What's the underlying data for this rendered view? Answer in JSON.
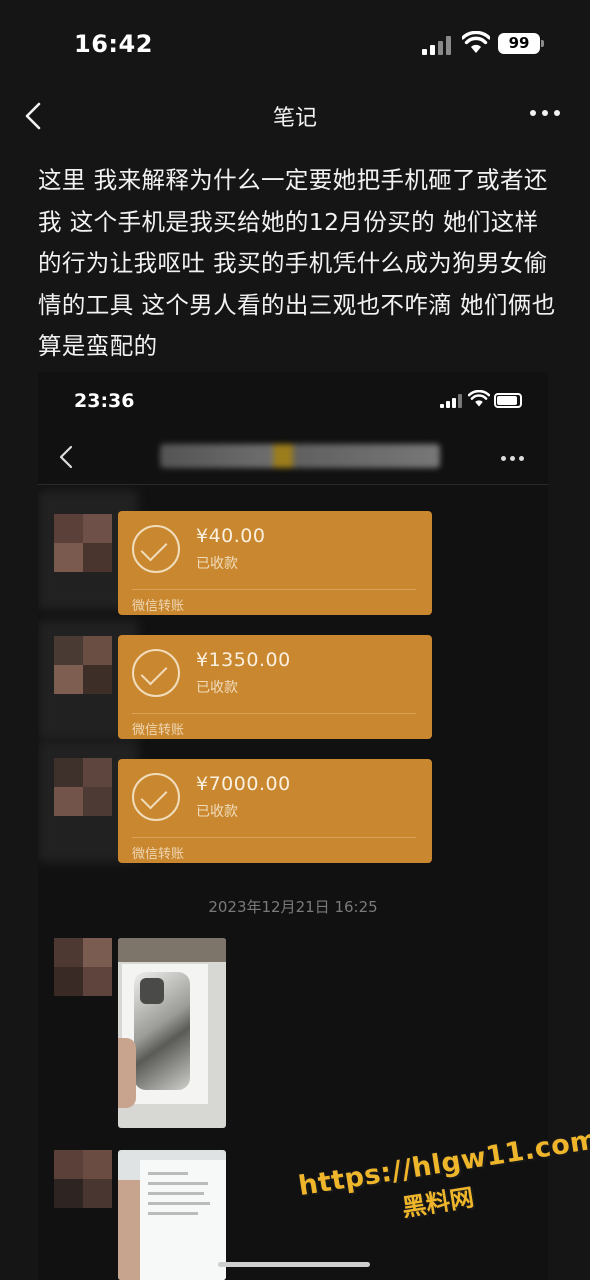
{
  "status_bar": {
    "time": "16:42",
    "battery": "99"
  },
  "header": {
    "title": "笔记"
  },
  "note": {
    "text": "这里 我来解释为什么一定要她把手机砸了或者还我 这个手机是我买给她的12月份买的 她们这样的行为让我呕吐 我买的手机凭什么成为狗男女偷情的工具 这个男人看的出三观也不咋滴 她们俩也算是蛮配的"
  },
  "embedded_screenshot": {
    "status_time": "23:36",
    "transfers": [
      {
        "amount": "¥40.00",
        "status": "已收款",
        "footer": "微信转账"
      },
      {
        "amount": "¥1350.00",
        "status": "已收款",
        "footer": "微信转账"
      },
      {
        "amount": "¥7000.00",
        "status": "已收款",
        "footer": "微信转账"
      }
    ],
    "timestamp": "2023年12月21日 16:25"
  },
  "watermark": {
    "url": "https://hlgw11.com",
    "name": "黑料网"
  },
  "colors": {
    "transfer_bubble": "#c9882f",
    "background": "#151515",
    "watermark": "#f0b62b"
  }
}
